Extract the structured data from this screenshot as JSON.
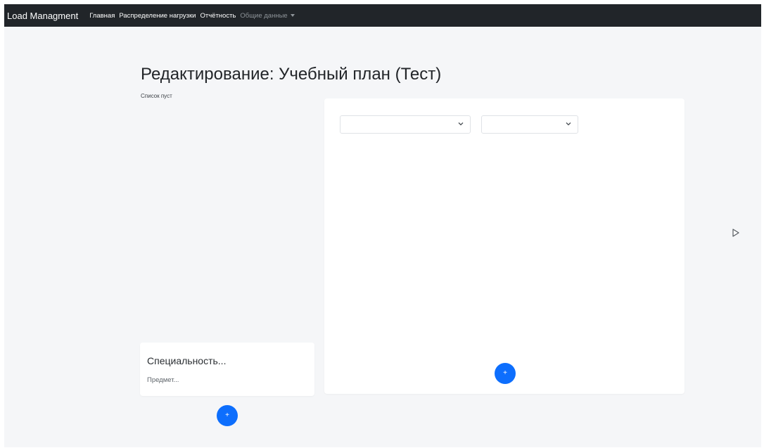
{
  "navbar": {
    "brand": "Load Managment",
    "links": [
      {
        "label": "Главная"
      },
      {
        "label": "Распределение нагрузки"
      },
      {
        "label": "Отчётность"
      },
      {
        "label": "Общие данные"
      }
    ]
  },
  "page": {
    "title": "Редактирование: Учебный план (Тест)",
    "empty_note": "Список пуст"
  },
  "spec_card": {
    "title": "Специальность...",
    "subtitle": "Предмет..."
  },
  "main_card": {
    "select1_value": "",
    "select2_value": ""
  },
  "buttons": {
    "add_main_label": "+",
    "add_left_label": "+"
  },
  "colors": {
    "navbar_bg": "#212529",
    "accent": "#0d6efd",
    "page_bg": "#f5f6f8"
  },
  "icons": {
    "select_chevron": "chevron-down-icon",
    "dropdown_caret": "caret-down-icon",
    "cursor": "mouse-cursor-icon"
  }
}
